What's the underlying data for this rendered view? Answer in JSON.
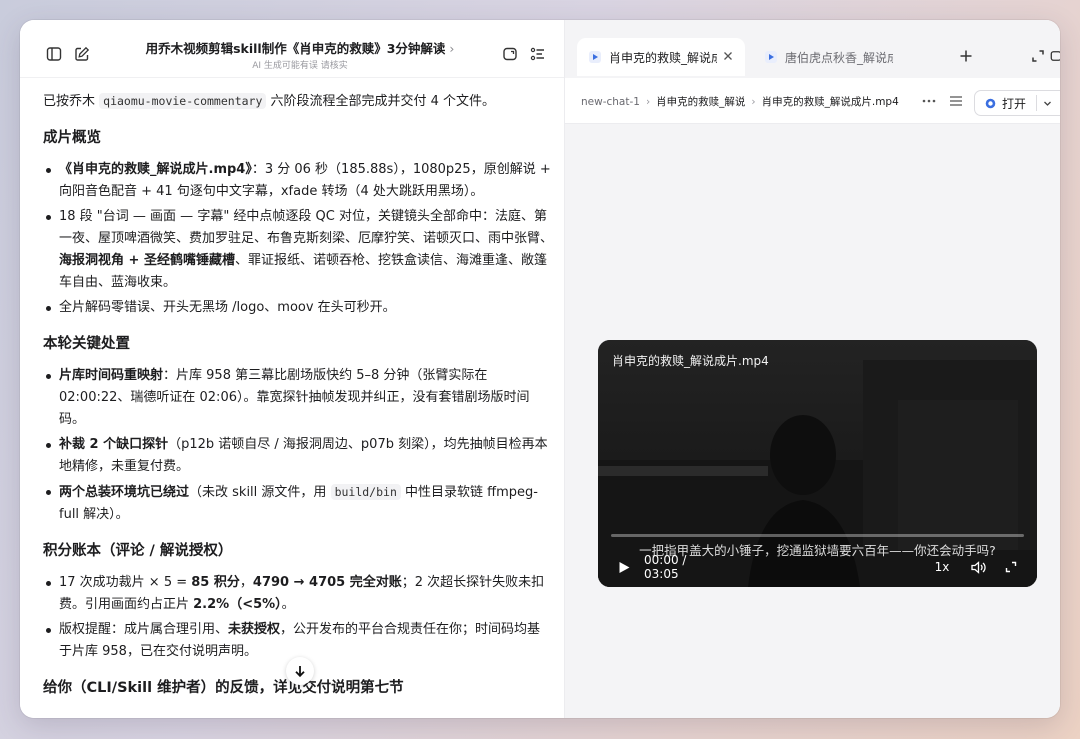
{
  "left_pane": {
    "header": {
      "title": "用乔木视频剪辑skill制作《肖申克的救赎》3分钟解读",
      "title_chevron": "›",
      "subtitle": "AI 生成可能有误 请核实"
    },
    "intro": {
      "pre": "已按乔木 ",
      "code": "qiaomu-movie-commentary",
      "post": " 六阶段流程全部完成并交付 4 个文件。"
    },
    "section1": {
      "title": "成片概览",
      "item1": {
        "bold": "《肖申克的救赎_解说成片.mp4》",
        "rest": "：3 分 06 秒（185.88s），1080p25，原创解说 + 向阳音色配音 + 41 句逐句中文字幕，xfade 转场（4 处大跳跃用黑场）。"
      },
      "item2": {
        "pre": "18 段 \"台词 — 画面 — 字幕\" 经中点帧逐段 QC 对位，关键镜头全部命中：法庭、第一夜、屋顶啤酒微笑、费加罗驻足、布鲁克斯刻梁、厄摩狞笑、诺顿灭口、雨中张臂、",
        "bold": "海报洞视角 + 圣经鹤嘴锤藏槽",
        "post": "、罪证报纸、诺顿吞枪、挖铁盒读信、海滩重逢、敞篷车自由、蓝海收束。"
      },
      "item3": "全片解码零错误、开头无黑场 /logo、moov 在头可秒开。"
    },
    "section2": {
      "title": "本轮关键处置",
      "item1": {
        "bold": "片库时间码重映射",
        "rest": "：片库 958 第三幕比剧场版快约 5–8 分钟（张臂实际在 02:00:22、瑞德听证在 02:06）。靠宽探针抽帧发现并纠正，没有套错剧场版时间码。"
      },
      "item2": {
        "bold": "补裁 2 个缺口探针",
        "rest": "（p12b 诺顿自尽 / 海报洞周边、p07b 刻梁），均先抽帧目检再本地精修，未重复付费。"
      },
      "item3": {
        "bold": "两个总装环境坑已绕过",
        "pre": "（未改 skill 源文件，用 ",
        "code": "build/bin",
        "post": " 中性目录软链 ffmpeg-full 解决）。"
      }
    },
    "section3": {
      "title": "积分账本（评论 / 解说授权）",
      "item1": {
        "pre": "17 次成功裁片 × 5 = ",
        "bold1": "85 积分",
        "mid1": "，",
        "bold2": "4790 → 4705 完全对账",
        "mid2": "；2 次超长探针失败未扣费。引用画面约占正片 ",
        "bold3": "2.2%（<5%）",
        "post": "。"
      },
      "item2": {
        "pre": "版权提醒：成片属合理引用、",
        "bold": "未获授权",
        "post": "，公开发布的平台合规责任在你；时间码均基于片库 958，已在交付说明声明。"
      }
    },
    "section4": {
      "title": "给你（CLI/Skill 维护者）的反馈，详见交付说明第七节"
    }
  },
  "right_pane": {
    "tabs": [
      {
        "label": "肖申克的救赎_解说成片.mp4",
        "active": true
      },
      {
        "label": "唐伯虎点秋香_解说成片.mp4",
        "active": false
      }
    ],
    "breadcrumb": [
      "new-chat-1",
      "肖申克的救赎_解说",
      "肖申克的救赎_解说成片.mp4"
    ],
    "open_button": "打开",
    "video": {
      "title": "肖申克的救赎_解说成片.mp4",
      "subtitle": "一把指甲盖大的小锤子，挖通监狱墙要六百年——你还会动手吗?",
      "time": "00:00 / 03:05",
      "speed": "1x",
      "progress": 0.0
    }
  },
  "colors": {
    "accent": "#3b6fe0",
    "text": "#1d1d1f",
    "muted": "#9a9aa0"
  }
}
